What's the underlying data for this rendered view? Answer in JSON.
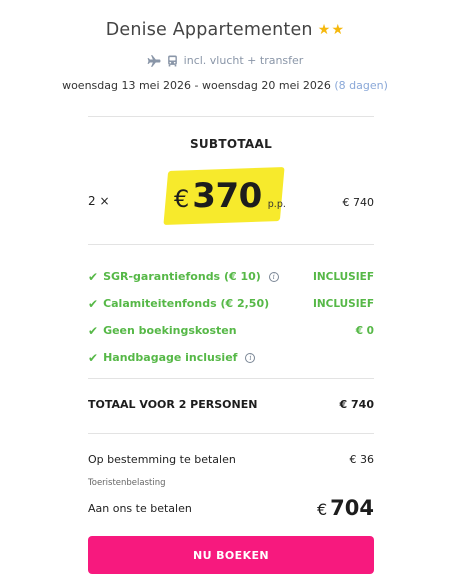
{
  "hotel": {
    "name": "Denise Appartementen",
    "stars": 2,
    "star_color": "#f5b80d"
  },
  "transport": {
    "icons": [
      "plane-icon",
      "bus-icon"
    ],
    "label": "incl. vlucht + transfer"
  },
  "dates": {
    "range": "woensdag 13 mei 2026 - woensdag 20 mei 2026",
    "duration": "(8 dagen)"
  },
  "subtotal": {
    "title": "SUBTOTAAL",
    "quantity": "2 ×",
    "currency": "€",
    "price_per_person": "370",
    "per_person_label": "p.p.",
    "row_total": "€ 740",
    "highlight_color": "#f7ea2c"
  },
  "inclusions": [
    {
      "label": "SGR-garantiefonds (€ 10)",
      "info": true,
      "value": "INCLUSIEF"
    },
    {
      "label": "Calamiteitenfonds (€ 2,50)",
      "info": false,
      "value": "INCLUSIEF"
    },
    {
      "label": "Geen boekingskosten",
      "info": false,
      "value": "€ 0"
    },
    {
      "label": "Handbagage inclusief",
      "info": true,
      "value": ""
    }
  ],
  "inclusion_color": "#56b847",
  "total": {
    "label": "TOTAAL VOOR 2 PERSONEN",
    "value": "€ 740"
  },
  "payment": {
    "destination_label": "Op bestemming te betalen",
    "destination_value": "€ 36",
    "tourist_tax_label": "Toeristenbelasting",
    "to_us_label": "Aan ons te betalen",
    "to_us_currency": "€",
    "to_us_amount": "704"
  },
  "cta": {
    "label": "NU BOEKEN",
    "color": "#f7197e"
  }
}
